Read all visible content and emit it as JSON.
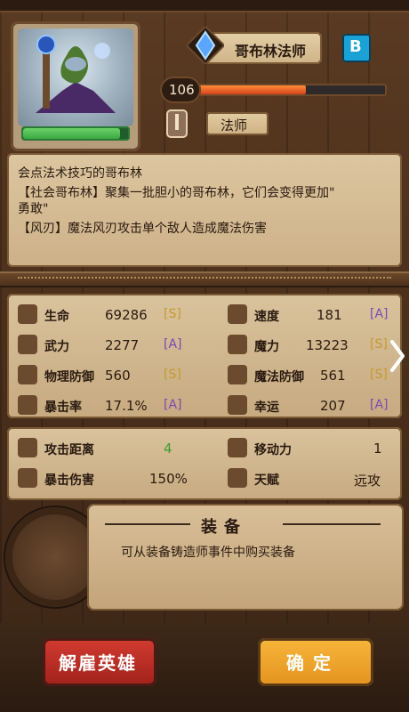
{
  "hero": {
    "name": "哥布林法师",
    "grade": "B",
    "level": "106",
    "class": "法师",
    "hp_bar_fraction": 0.92,
    "xp_bar_fraction": 0.58
  },
  "description": {
    "title": "会点法术技巧的哥布林",
    "line1": "【社会哥布林】聚集一批胆小的哥布林，它们会变得更加\"",
    "line2": "勇敢\"",
    "line3": "【风刃】魔法风刃攻击单个敌人造成魔法伤害"
  },
  "stats": [
    {
      "label": "生命",
      "value": "69286",
      "rank": "[S]",
      "icon": "heart-icon"
    },
    {
      "label": "速度",
      "value": "181",
      "rank": "[A]",
      "icon": "boot-icon"
    },
    {
      "label": "武力",
      "value": "2277",
      "rank": "[A]",
      "icon": "sword-icon"
    },
    {
      "label": "魔力",
      "value": "13223",
      "rank": "[S]",
      "icon": "sparkle-icon"
    },
    {
      "label": "物理防御",
      "value": "560",
      "rank": "[S]",
      "icon": "shield-icon"
    },
    {
      "label": "魔法防御",
      "value": "561",
      "rank": "[S]",
      "icon": "magic-shield-icon"
    },
    {
      "label": "暴击率",
      "value": "17.1%",
      "rank": "[A]",
      "icon": "burst-icon"
    },
    {
      "label": "幸运",
      "value": "207",
      "rank": "[A]",
      "icon": "clover-icon"
    }
  ],
  "stats2": [
    {
      "label": "攻击距离",
      "value": "4",
      "icon": "target-icon"
    },
    {
      "label": "移动力",
      "value": "1",
      "icon": "tower-icon"
    },
    {
      "label": "暴击伤害",
      "value": "150%",
      "icon": "crit-damage-icon"
    },
    {
      "label": "天赋",
      "value": "远攻",
      "icon": "talent-icon"
    }
  ],
  "equipment": {
    "title": "装备",
    "subtitle": "可从装备铸造师事件中购买装备"
  },
  "buttons": {
    "dismiss": "解雇英雄",
    "confirm": "确定"
  }
}
